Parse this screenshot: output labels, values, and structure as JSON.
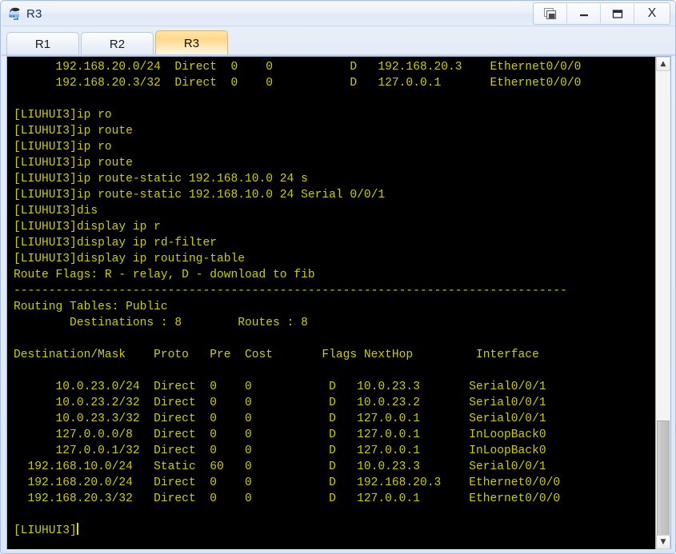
{
  "window": {
    "title": "R3",
    "app_icon": "router-icon",
    "controls": {
      "restore_label": "",
      "restore_icon": "restore-windows-icon",
      "minimize_label": "",
      "minimize_icon": "minimize-icon",
      "maximize_label": "",
      "maximize_icon": "maximize-icon",
      "close_label": "X",
      "close_icon": "close-icon"
    }
  },
  "tabs": [
    {
      "label": "R1",
      "active": false
    },
    {
      "label": "R2",
      "active": false
    },
    {
      "label": "R3",
      "active": true
    }
  ],
  "terminal": {
    "foreground": "#cccc00",
    "background": "#000000",
    "prompt": "[LIUHUI3]",
    "cursor_visible": true,
    "lines": [
      "      192.168.20.0/24  Direct  0    0           D   192.168.20.3    Ethernet0/0/0",
      "      192.168.20.3/32  Direct  0    0           D   127.0.0.1       Ethernet0/0/0",
      "",
      "[LIUHUI3]ip ro",
      "[LIUHUI3]ip route",
      "[LIUHUI3]ip ro",
      "[LIUHUI3]ip route",
      "[LIUHUI3]ip route-static 192.168.10.0 24 s",
      "[LIUHUI3]ip route-static 192.168.10.0 24 Serial 0/0/1",
      "[LIUHUI3]dis",
      "[LIUHUI3]display ip r",
      "[LIUHUI3]display ip rd-filter",
      "[LIUHUI3]display ip routing-table",
      "Route Flags: R - relay, D - download to fib",
      "-------------------------------------------------------------------------------",
      "Routing Tables: Public",
      "        Destinations : 8        Routes : 8",
      "",
      "Destination/Mask    Proto   Pre  Cost       Flags NextHop         Interface",
      "",
      "      10.0.23.0/24  Direct  0    0           D   10.0.23.3       Serial0/0/1",
      "      10.0.23.2/32  Direct  0    0           D   10.0.23.2       Serial0/0/1",
      "      10.0.23.3/32  Direct  0    0           D   127.0.0.1       Serial0/0/1",
      "      127.0.0.0/8   Direct  0    0           D   127.0.0.1       InLoopBack0",
      "      127.0.0.1/32  Direct  0    0           D   127.0.0.1       InLoopBack0",
      "  192.168.10.0/24   Static  60   0           D   10.0.23.3       Serial0/0/1",
      "  192.168.20.0/24   Direct  0    0           D   192.168.20.3    Ethernet0/0/0",
      "  192.168.20.3/32   Direct  0    0           D   127.0.0.1       Ethernet0/0/0",
      ""
    ],
    "routing_table": {
      "flags_legend": "Route Flags: R - relay, D - download to fib",
      "table_name": "Routing Tables: Public",
      "destinations_label": "Destinations",
      "destinations_count": "8",
      "routes_label": "Routes",
      "routes_count": "8",
      "headers": [
        "Destination/Mask",
        "Proto",
        "Pre",
        "Cost",
        "Flags",
        "NextHop",
        "Interface"
      ],
      "rows": [
        [
          "10.0.23.0/24",
          "Direct",
          "0",
          "0",
          "D",
          "10.0.23.3",
          "Serial0/0/1"
        ],
        [
          "10.0.23.2/32",
          "Direct",
          "0",
          "0",
          "D",
          "10.0.23.2",
          "Serial0/0/1"
        ],
        [
          "10.0.23.3/32",
          "Direct",
          "0",
          "0",
          "D",
          "127.0.0.1",
          "Serial0/0/1"
        ],
        [
          "127.0.0.0/8",
          "Direct",
          "0",
          "0",
          "D",
          "127.0.0.1",
          "InLoopBack0"
        ],
        [
          "127.0.0.1/32",
          "Direct",
          "0",
          "0",
          "D",
          "127.0.0.1",
          "InLoopBack0"
        ],
        [
          "192.168.10.0/24",
          "Static",
          "60",
          "0",
          "D",
          "10.0.23.3",
          "Serial0/0/1"
        ],
        [
          "192.168.20.0/24",
          "Direct",
          "0",
          "0",
          "D",
          "192.168.20.3",
          "Ethernet0/0/0"
        ],
        [
          "192.168.20.3/32",
          "Direct",
          "0",
          "0",
          "D",
          "127.0.0.1",
          "Ethernet0/0/0"
        ]
      ]
    },
    "commands_entered": [
      "ip ro",
      "ip route",
      "ip ro",
      "ip route",
      "ip route-static 192.168.10.0 24 s",
      "ip route-static 192.168.10.0 24 Serial 0/0/1",
      "dis",
      "display ip r",
      "display ip rd-filter",
      "display ip routing-table"
    ]
  },
  "scrollbar": {
    "up_arrow": "▲",
    "down_arrow": "▼",
    "thumb_name": "scrollbar-thumb"
  }
}
